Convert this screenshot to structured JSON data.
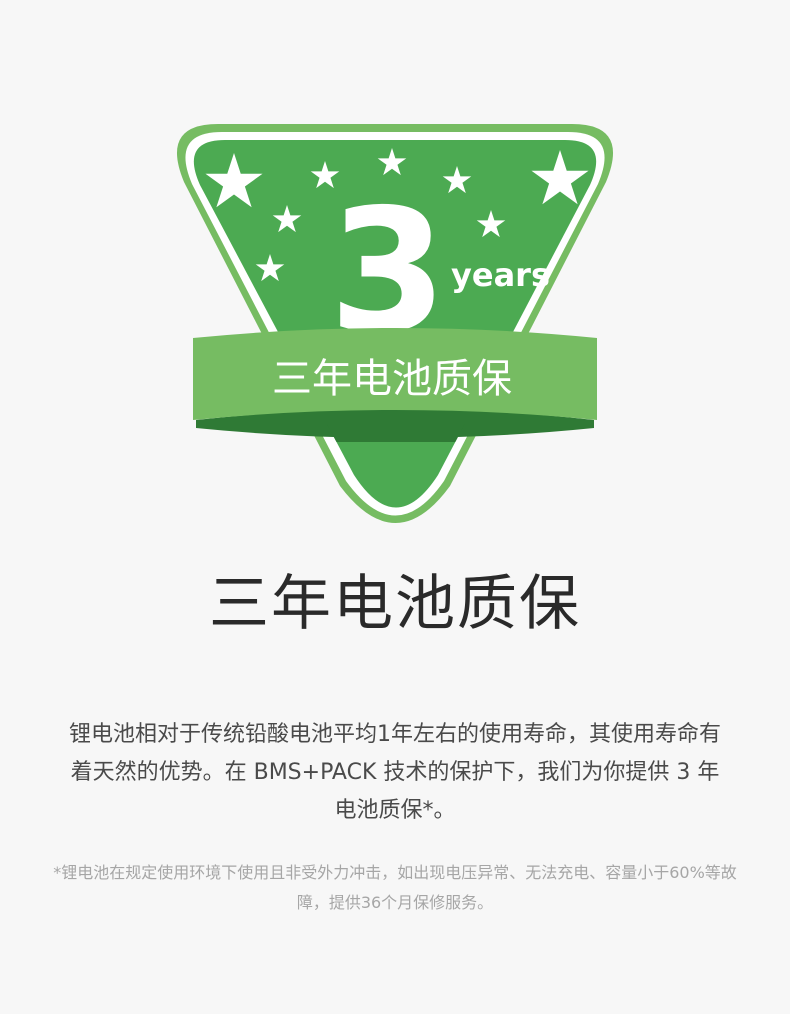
{
  "badge": {
    "number": "3",
    "unit": "years",
    "ribbon_text": "三年电池质保",
    "colors": {
      "primary_green": "#4caa52",
      "light_green": "#76bc62",
      "dark_green": "#2f7a35",
      "white": "#ffffff"
    },
    "icons": [
      "star-icon"
    ]
  },
  "headline": "三年电池质保",
  "description": "锂电池相对于传统铅酸电池平均1年左右的使用寿命，其使用寿命有着天然的优势。在 BMS+PACK 技术的保护下，我们为你提供 3 年电池质保*。",
  "footnote": "*锂电池在规定使用环境下使用且非受外力冲击，如出现电压异常、无法充电、容量小于60%等故障，提供36个月保修服务。"
}
